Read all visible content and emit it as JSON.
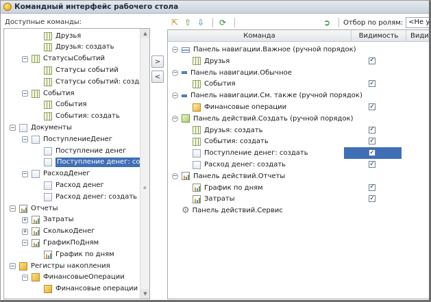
{
  "window": {
    "title": "Командный интерфейс рабочего стола"
  },
  "left": {
    "caption": "Доступные команды:",
    "tree": [
      {
        "label": "Друзья",
        "icon": "table-icon",
        "level": 3,
        "expander": null,
        "selected": false
      },
      {
        "label": "Друзья: создать",
        "icon": "table-icon",
        "level": 3,
        "expander": null,
        "selected": false
      },
      {
        "label": "СтатусыСобытий",
        "icon": "table-icon",
        "level": 2,
        "expander": "−",
        "selected": false
      },
      {
        "label": "Статусы событий",
        "icon": "table-icon",
        "level": 3,
        "expander": null,
        "selected": false
      },
      {
        "label": "Статусы событий: создать",
        "icon": "table-icon",
        "level": 3,
        "expander": null,
        "selected": false
      },
      {
        "label": "События",
        "icon": "table-icon",
        "level": 2,
        "expander": "−",
        "selected": false
      },
      {
        "label": "События",
        "icon": "table-icon",
        "level": 3,
        "expander": null,
        "selected": false
      },
      {
        "label": "События: создать",
        "icon": "table-icon",
        "level": 3,
        "expander": null,
        "selected": false
      },
      {
        "label": "Документы",
        "icon": "document-icon",
        "level": 1,
        "expander": "−",
        "selected": false
      },
      {
        "label": "ПоступлениеДенег",
        "icon": "document-icon",
        "level": 2,
        "expander": "−",
        "selected": false
      },
      {
        "label": "Поступление денег",
        "icon": "document-icon",
        "level": 3,
        "expander": null,
        "selected": false
      },
      {
        "label": "Поступление денег: создать",
        "icon": "document-icon",
        "level": 3,
        "expander": null,
        "selected": true
      },
      {
        "label": "РасходДенег",
        "icon": "document-icon",
        "level": 2,
        "expander": "−",
        "selected": false
      },
      {
        "label": "Расход денег",
        "icon": "document-icon",
        "level": 3,
        "expander": null,
        "selected": false
      },
      {
        "label": "Расход денег: создать",
        "icon": "document-icon",
        "level": 3,
        "expander": null,
        "selected": false
      },
      {
        "label": "Отчеты",
        "icon": "report-icon",
        "level": 1,
        "expander": "−",
        "selected": false
      },
      {
        "label": "Затраты",
        "icon": "report-icon",
        "level": 2,
        "expander": "+",
        "selected": false
      },
      {
        "label": "СколькоДенег",
        "icon": "report-icon",
        "level": 2,
        "expander": "+",
        "selected": false
      },
      {
        "label": "ГрафикПоДням",
        "icon": "report-icon",
        "level": 2,
        "expander": "−",
        "selected": false
      },
      {
        "label": "График по дням",
        "icon": "report-icon",
        "level": 3,
        "expander": null,
        "selected": false
      },
      {
        "label": "Регистры накопления",
        "icon": "register-icon",
        "level": 1,
        "expander": "−",
        "selected": false
      },
      {
        "label": "ФинансовыеОперации",
        "icon": "register-icon",
        "level": 2,
        "expander": "−",
        "selected": false
      },
      {
        "label": "Финансовые операции",
        "icon": "register-icon",
        "level": 3,
        "expander": null,
        "selected": false
      }
    ]
  },
  "middle": {
    "add_label": ">",
    "remove_label": "<"
  },
  "toolbar": {
    "filter_label": "Отбор по ролям:",
    "filter_value": "<Не установлен>"
  },
  "right": {
    "columns": [
      "Команда",
      "Видимость",
      "Видимость"
    ],
    "rows": [
      {
        "label": "Панель навигации.Важное (ручной порядок)",
        "type": "group",
        "icon": "panel-icon",
        "checked": null
      },
      {
        "label": "Друзья",
        "type": "item",
        "icon": "table-icon",
        "checked": true
      },
      {
        "label": "Панель навигации.Обычное",
        "type": "group",
        "icon": "minus-icon",
        "checked": null
      },
      {
        "label": "События",
        "type": "item",
        "icon": "table-icon",
        "checked": true
      },
      {
        "label": "Панель навигации.См. также (ручной порядок)",
        "type": "group",
        "icon": "minus-icon",
        "checked": null
      },
      {
        "label": "Финансовые операции",
        "type": "item",
        "icon": "register-icon",
        "checked": true
      },
      {
        "label": "Панель действий.Создать (ручной порядок)",
        "type": "group",
        "icon": "action-icon",
        "checked": null
      },
      {
        "label": "Друзья: создать",
        "type": "item",
        "icon": "table-icon",
        "checked": true
      },
      {
        "label": "События: создать",
        "type": "item",
        "icon": "table-icon",
        "checked": true
      },
      {
        "label": "Поступление денег: создать",
        "type": "item",
        "icon": "document-icon",
        "checked": true,
        "highlight": true
      },
      {
        "label": "Расход денег: создать",
        "type": "item",
        "icon": "document-icon",
        "checked": true
      },
      {
        "label": "Панель действий.Отчеты",
        "type": "group",
        "icon": "report-icon",
        "checked": null
      },
      {
        "label": "График по дням",
        "type": "item",
        "icon": "report-icon",
        "checked": true
      },
      {
        "label": "Затраты",
        "type": "item",
        "icon": "report-icon",
        "checked": true
      },
      {
        "label": "Панель действий.Сервис",
        "type": "group-nocollapse",
        "icon": "gear-icon",
        "checked": null
      }
    ]
  },
  "colors": {
    "selection": "#3f6fb5",
    "title_bg": "#c9d2db"
  }
}
